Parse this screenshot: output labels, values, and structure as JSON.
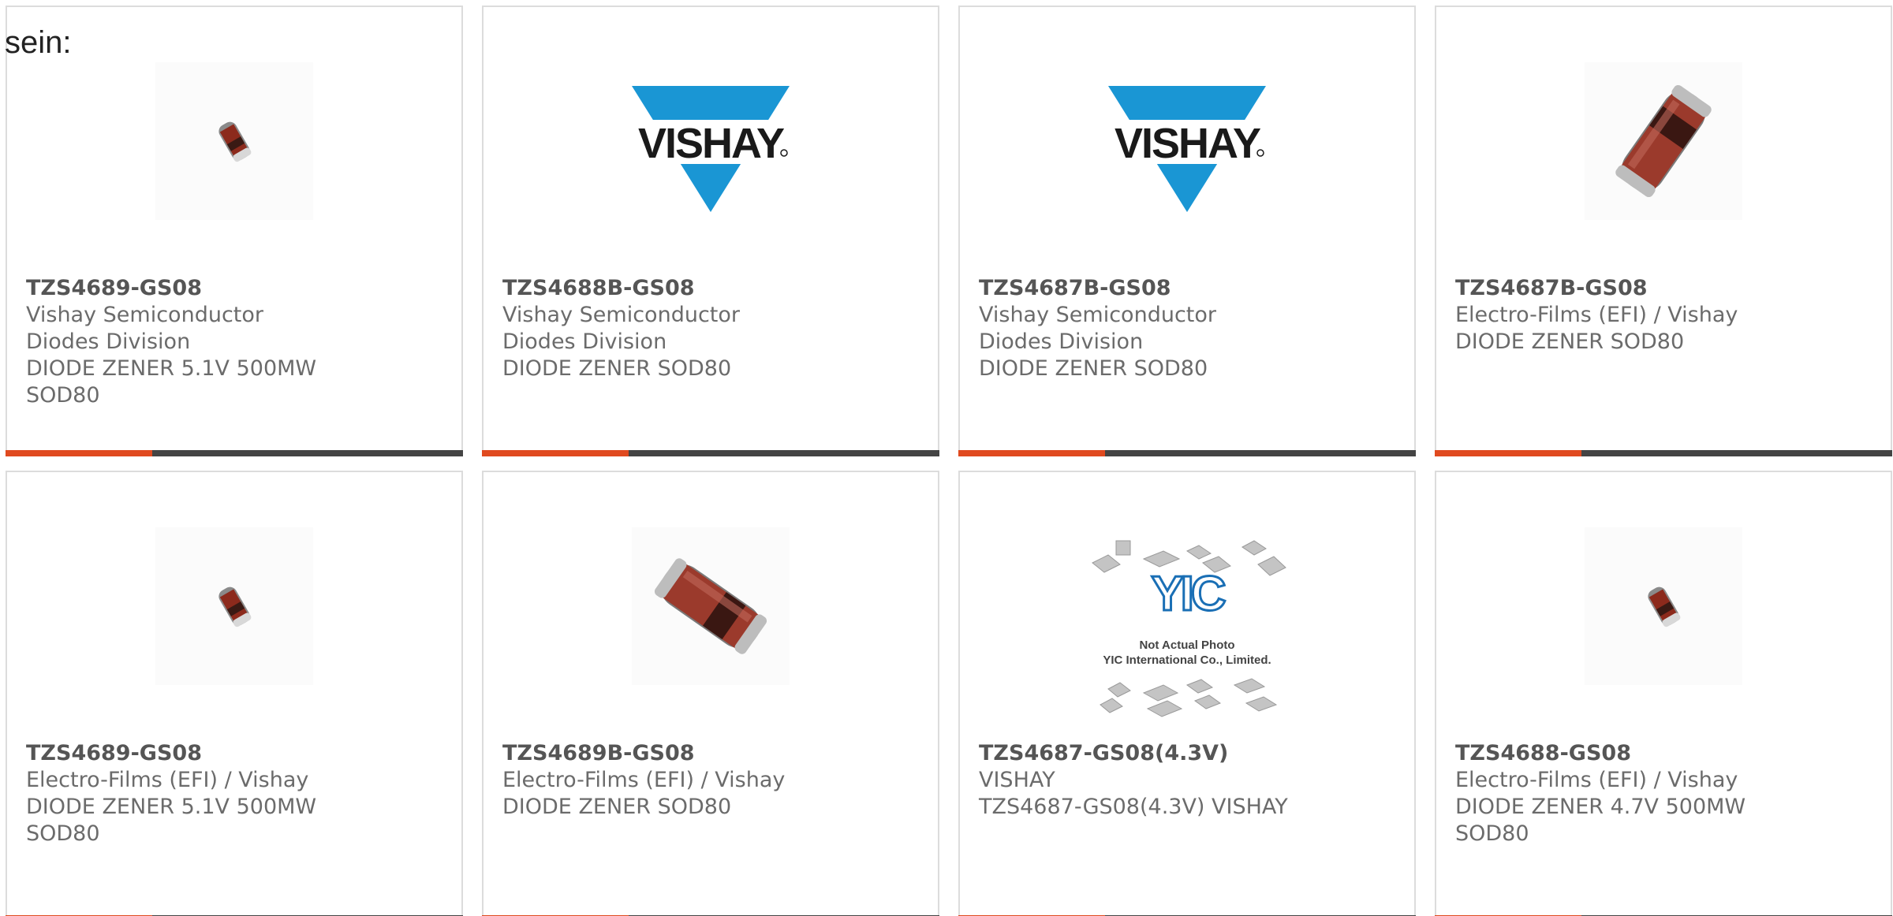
{
  "intro_text": "sein:",
  "colors": {
    "accent": "#e04a1f",
    "bar": "#444444",
    "vishay_blue": "#1a96d4"
  },
  "products": [
    {
      "image": "diode-small-icon",
      "part": "TZS4689-GS08",
      "manufacturer": "Vishay Semiconductor Diodes Division",
      "description": "DIODE ZENER 5.1V 500MW SOD80",
      "progress": 0.32
    },
    {
      "image": "vishay-logo",
      "part": "TZS4688B-GS08",
      "manufacturer": "Vishay Semiconductor Diodes Division",
      "description": "DIODE ZENER SOD80",
      "progress": 0.32
    },
    {
      "image": "vishay-logo",
      "part": "TZS4687B-GS08",
      "manufacturer": "Vishay Semiconductor Diodes Division",
      "description": "DIODE ZENER SOD80",
      "progress": 0.32
    },
    {
      "image": "diode-large-icon",
      "part": "TZS4687B-GS08",
      "manufacturer": "Electro-Films (EFI) / Vishay",
      "description": "DIODE ZENER SOD80",
      "progress": 0.32
    },
    {
      "image": "diode-small-icon",
      "part": "TZS4689-GS08",
      "manufacturer": "Electro-Films (EFI) / Vishay",
      "description": "DIODE ZENER 5.1V 500MW SOD80",
      "progress": 0.32
    },
    {
      "image": "diode-large-icon",
      "part": "TZS4689B-GS08",
      "manufacturer": "Electro-Films (EFI) / Vishay",
      "description": "DIODE ZENER SOD80",
      "progress": 0.32
    },
    {
      "image": "yic-placeholder",
      "part": "TZS4687-GS08(4.3V)",
      "manufacturer": "VISHAY",
      "description": "TZS4687-GS08(4.3V) VISHAY",
      "progress": 0.32,
      "image_text": [
        "Not Actual Photo",
        "YIC International Co., Limited."
      ]
    },
    {
      "image": "diode-small-icon",
      "part": "TZS4688-GS08",
      "manufacturer": "Electro-Films (EFI) / Vishay",
      "description": "DIODE ZENER 4.7V 500MW SOD80",
      "progress": 0.32
    }
  ]
}
